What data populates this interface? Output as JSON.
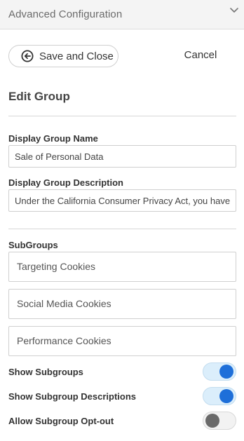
{
  "header": {
    "title": "Advanced Configuration",
    "collapse_icon": "chevron-down-icon"
  },
  "actions": {
    "save_label": "Save and Close",
    "save_icon": "back-arrow-circle-icon",
    "cancel_label": "Cancel"
  },
  "edit_group": {
    "title": "Edit Group",
    "name_label": "Display Group Name",
    "name_value": "Sale of Personal Data",
    "description_label": "Display Group Description",
    "description_value": "Under the California Consumer Privacy Act, you have the right"
  },
  "subgroups": {
    "label": "SubGroups",
    "items": [
      {
        "label": "Targeting Cookies"
      },
      {
        "label": "Social Media Cookies"
      },
      {
        "label": "Performance Cookies"
      }
    ]
  },
  "toggles": [
    {
      "label": "Show Subgroups",
      "on": true
    },
    {
      "label": "Show Subgroup Descriptions",
      "on": true
    },
    {
      "label": "Allow Subgroup Opt-out",
      "on": false
    }
  ],
  "colors": {
    "accent": "#1e6fd9",
    "toggle_on_track": "#dbeefb",
    "toggle_off_knob": "#6a6a6a"
  }
}
